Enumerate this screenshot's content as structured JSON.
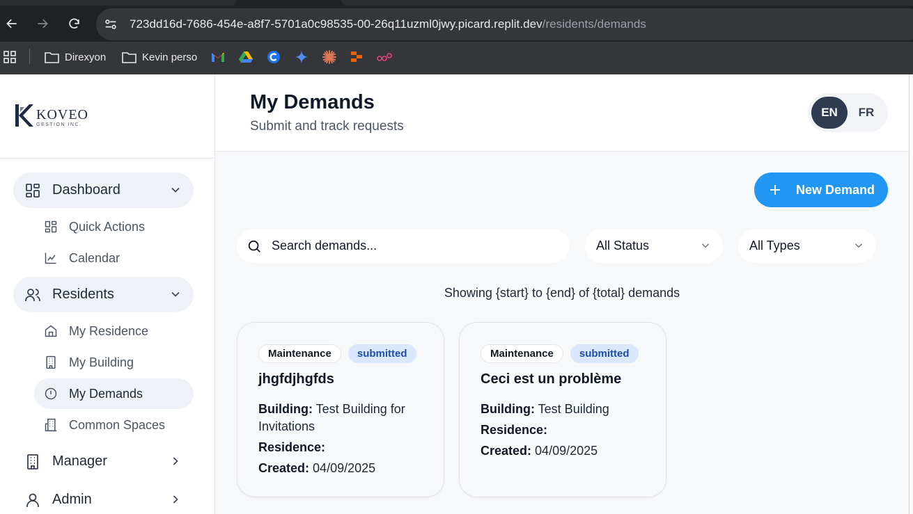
{
  "browser": {
    "url_host": "723dd16d-7686-454e-a8f7-5701a0c98535-00-26q11uzml0jwy.picard.replit.dev",
    "url_path": "/residents/demands",
    "bookmarks": [
      {
        "label": "Direxyon",
        "icon": "folder-icon"
      },
      {
        "label": "Kevin perso",
        "icon": "folder-icon"
      }
    ],
    "bookmark_icons": [
      "gmail-icon",
      "drive-icon",
      "c-app-icon",
      "gemini-icon",
      "claude-icon",
      "stack-app-icon",
      "link-app-icon"
    ]
  },
  "logo": {
    "name": "KOVEO",
    "sub": "GESTION INC."
  },
  "sidebar": {
    "dashboard": {
      "label": "Dashboard",
      "items": [
        "Quick Actions",
        "Calendar"
      ]
    },
    "residents": {
      "label": "Residents",
      "items": [
        "My Residence",
        "My Building",
        "My Demands",
        "Common Spaces"
      ]
    },
    "manager": {
      "label": "Manager"
    },
    "admin": {
      "label": "Admin"
    },
    "active_item": "My Demands"
  },
  "header": {
    "title": "My Demands",
    "subtitle": "Submit and track requests",
    "lang_en": "EN",
    "lang_fr": "FR"
  },
  "toolbar": {
    "new_label": "New Demand",
    "search_placeholder": "Search demands...",
    "status_filter": "All Status",
    "type_filter": "All Types"
  },
  "showing_text": "Showing {start} to {end} of {total} demands",
  "labels": {
    "building": "Building:",
    "residence": "Residence:",
    "created": "Created:"
  },
  "demands": [
    {
      "type": "Maintenance",
      "status": "submitted",
      "title": "jhgfdjhgfds",
      "building": "Test Building for Invitations",
      "residence": "",
      "created": "04/09/2025"
    },
    {
      "type": "Maintenance",
      "status": "submitted",
      "title": "Ceci est un problème",
      "building": "Test Building",
      "residence": "",
      "created": "04/09/2025"
    }
  ],
  "colors": {
    "accent": "#2196f3",
    "status_bg": "#dbe7fb",
    "status_text": "#1e4fa8",
    "active_lang": "#2f3b4f"
  }
}
